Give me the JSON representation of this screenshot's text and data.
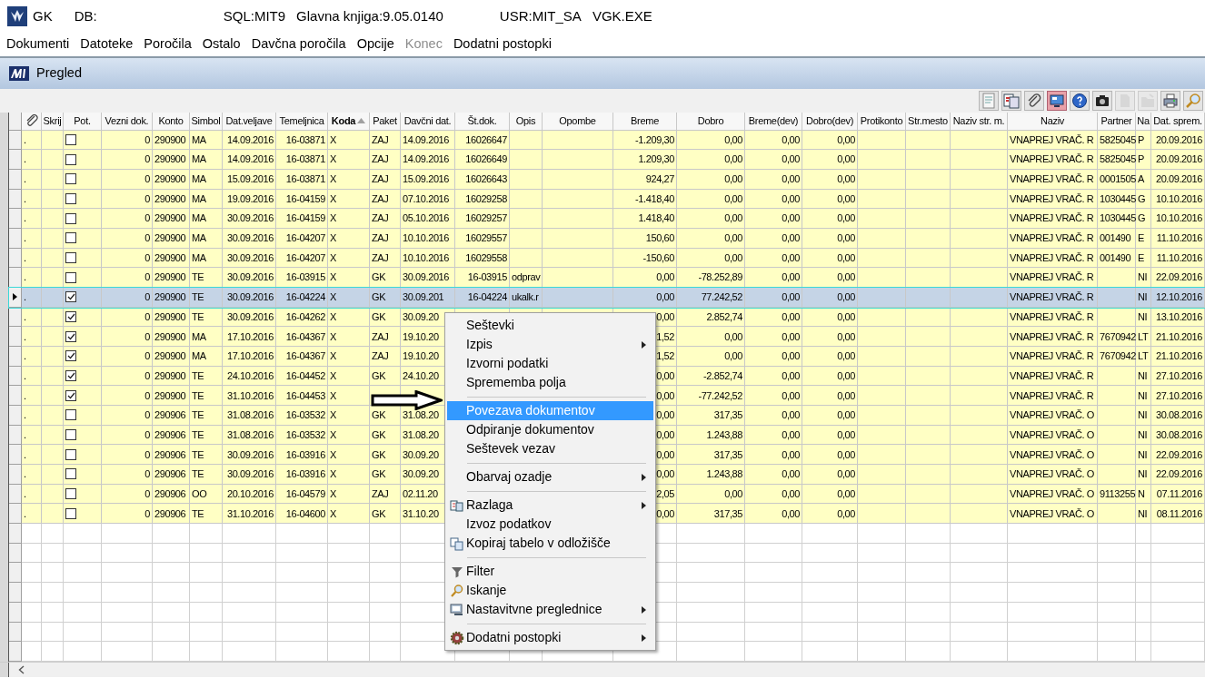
{
  "title_bar": {
    "app": "GK",
    "db": "DB:",
    "sql": "SQL:MIT9",
    "module": "Glavna knjiga:9.05.0140",
    "user": "USR:MIT_SA",
    "exe": "VGK.EXE"
  },
  "menu_bar": [
    {
      "label": "Dokumenti",
      "disabled": false
    },
    {
      "label": "Datoteke",
      "disabled": false
    },
    {
      "label": "Poročila",
      "disabled": false
    },
    {
      "label": "Ostalo",
      "disabled": false
    },
    {
      "label": "Davčna poročila",
      "disabled": false
    },
    {
      "label": "Opcije",
      "disabled": false
    },
    {
      "label": "Konec",
      "disabled": true
    },
    {
      "label": "Dodatni postopki",
      "disabled": false
    }
  ],
  "window": {
    "title": "Pregled"
  },
  "toolbar": [
    {
      "pressed": false,
      "disabled": false
    },
    {
      "pressed": false,
      "disabled": false
    },
    {
      "pressed": false,
      "disabled": false
    },
    {
      "pressed": true,
      "disabled": false
    },
    {
      "pressed": false,
      "disabled": false
    },
    {
      "pressed": false,
      "disabled": false
    },
    {
      "pressed": false,
      "disabled": true
    },
    {
      "pressed": false,
      "disabled": true
    },
    {
      "pressed": false,
      "disabled": false
    },
    {
      "pressed": false,
      "disabled": false
    }
  ],
  "table": {
    "columns": [
      {
        "kind": "icon",
        "sorted": false
      },
      {
        "label": "Skrij",
        "sorted": false
      },
      {
        "label": "Pot.",
        "sorted": false
      },
      {
        "label": "Vezni dok.",
        "sorted": false
      },
      {
        "label": "Konto",
        "sorted": false
      },
      {
        "label": "Simbol",
        "sorted": false
      },
      {
        "label": "Dat.veljave",
        "sorted": false
      },
      {
        "label": "Temeljnica",
        "sorted": false
      },
      {
        "label": "Koda",
        "sorted": true
      },
      {
        "label": "Paket",
        "sorted": false
      },
      {
        "label": "Davčni dat.",
        "sorted": false
      },
      {
        "label": "Št.dok.",
        "sorted": false
      },
      {
        "label": "Opis",
        "sorted": false
      },
      {
        "label": "Opombe",
        "sorted": false
      },
      {
        "label": "Breme",
        "sorted": false
      },
      {
        "label": "Dobro",
        "sorted": false
      },
      {
        "label": "Breme(dev)",
        "sorted": false
      },
      {
        "label": "Dobro(dev)",
        "sorted": false
      },
      {
        "label": "Protikonto",
        "sorted": false
      },
      {
        "label": "Str.mesto",
        "sorted": false
      },
      {
        "label": "Naziv str. m.",
        "sorted": false
      },
      {
        "label": "Naziv",
        "sorted": false
      },
      {
        "label": "Partner",
        "sorted": false
      },
      {
        "label": "Na",
        "sorted": false
      },
      {
        "label": "Dat. sprem.",
        "sorted": false
      }
    ],
    "rows": [
      {
        "selected": false,
        "checked": false,
        "cells": [
          ".",
          null,
          null,
          "0",
          "290900",
          "MA",
          "14.09.2016",
          "16-03871",
          "X",
          "ZAJ",
          "14.09.2016",
          "16026647",
          null,
          null,
          "-1.209,30",
          "0,00",
          "0,00",
          "0,00",
          null,
          null,
          null,
          "VNAPREJ VRAČ. R",
          "5825045",
          "P",
          "20.09.2016"
        ]
      },
      {
        "selected": false,
        "checked": false,
        "cells": [
          ".",
          null,
          null,
          "0",
          "290900",
          "MA",
          "14.09.2016",
          "16-03871",
          "X",
          "ZAJ",
          "14.09.2016",
          "16026649",
          null,
          null,
          "1.209,30",
          "0,00",
          "0,00",
          "0,00",
          null,
          null,
          null,
          "VNAPREJ VRAČ. R",
          "5825045",
          "P",
          "20.09.2016"
        ]
      },
      {
        "selected": false,
        "checked": false,
        "cells": [
          ".",
          null,
          null,
          "0",
          "290900",
          "MA",
          "15.09.2016",
          "16-03871",
          "X",
          "ZAJ",
          "15.09.2016",
          "16026643",
          null,
          null,
          "924,27",
          "0,00",
          "0,00",
          "0,00",
          null,
          null,
          null,
          "VNAPREJ VRAČ. R",
          "0001505",
          "A",
          "20.09.2016"
        ]
      },
      {
        "selected": false,
        "checked": false,
        "cells": [
          ".",
          null,
          null,
          "0",
          "290900",
          "MA",
          "19.09.2016",
          "16-04159",
          "X",
          "ZAJ",
          "07.10.2016",
          "16029258",
          null,
          null,
          "-1.418,40",
          "0,00",
          "0,00",
          "0,00",
          null,
          null,
          null,
          "VNAPREJ VRAČ. R",
          "1030445",
          "G",
          "10.10.2016"
        ]
      },
      {
        "selected": false,
        "checked": false,
        "cells": [
          ".",
          null,
          null,
          "0",
          "290900",
          "MA",
          "30.09.2016",
          "16-04159",
          "X",
          "ZAJ",
          "05.10.2016",
          "16029257",
          null,
          null,
          "1.418,40",
          "0,00",
          "0,00",
          "0,00",
          null,
          null,
          null,
          "VNAPREJ VRAČ. R",
          "1030445",
          "G",
          "10.10.2016"
        ]
      },
      {
        "selected": false,
        "checked": false,
        "cells": [
          ".",
          null,
          null,
          "0",
          "290900",
          "MA",
          "30.09.2016",
          "16-04207",
          "X",
          "ZAJ",
          "10.10.2016",
          "16029557",
          null,
          null,
          "150,60",
          "0,00",
          "0,00",
          "0,00",
          null,
          null,
          null,
          "VNAPREJ VRAČ. R",
          "001490",
          "E",
          "11.10.2016"
        ]
      },
      {
        "selected": false,
        "checked": false,
        "cells": [
          ".",
          null,
          null,
          "0",
          "290900",
          "MA",
          "30.09.2016",
          "16-04207",
          "X",
          "ZAJ",
          "10.10.2016",
          "16029558",
          null,
          null,
          "-150,60",
          "0,00",
          "0,00",
          "0,00",
          null,
          null,
          null,
          "VNAPREJ VRAČ. R",
          "001490",
          "E",
          "11.10.2016"
        ]
      },
      {
        "selected": false,
        "checked": false,
        "cells": [
          ".",
          null,
          null,
          "0",
          "290900",
          "TE",
          "30.09.2016",
          "16-03915",
          "X",
          "GK",
          "30.09.2016",
          "16-03915",
          "odprav",
          null,
          "0,00",
          "-78.252,89",
          "0,00",
          "0,00",
          null,
          null,
          null,
          "VNAPREJ VRAČ. R",
          null,
          "NI",
          "22.09.2016"
        ]
      },
      {
        "selected": true,
        "checked": true,
        "cells": [
          ".",
          null,
          null,
          "0",
          "290900",
          "TE",
          "30.09.2016",
          "16-04224",
          "X",
          "GK",
          "30.09.201",
          "16-04224",
          "ukalk.r",
          null,
          "0,00",
          "77.242,52",
          "0,00",
          "0,00",
          null,
          null,
          null,
          "VNAPREJ VRAČ. R",
          null,
          "NI",
          "12.10.2016"
        ]
      },
      {
        "selected": false,
        "checked": true,
        "cells": [
          ".",
          null,
          null,
          "0",
          "290900",
          "TE",
          "30.09.2016",
          "16-04262",
          "X",
          "GK",
          "30.09.20",
          null,
          null,
          null,
          "0,00",
          "2.852,74",
          "0,00",
          "0,00",
          null,
          null,
          null,
          "VNAPREJ VRAČ. R",
          null,
          "NI",
          "13.10.2016"
        ]
      },
      {
        "selected": false,
        "checked": true,
        "cells": [
          ".",
          null,
          null,
          "0",
          "290900",
          "MA",
          "17.10.2016",
          "16-04367",
          "X",
          "ZAJ",
          "19.10.20",
          null,
          null,
          null,
          "1,52",
          "0,00",
          "0,00",
          "0,00",
          null,
          null,
          null,
          "VNAPREJ VRAČ. R",
          "7670942",
          "LT",
          "21.10.2016"
        ]
      },
      {
        "selected": false,
        "checked": true,
        "cells": [
          ".",
          null,
          null,
          "0",
          "290900",
          "MA",
          "17.10.2016",
          "16-04367",
          "X",
          "ZAJ",
          "19.10.20",
          null,
          null,
          null,
          "1,52",
          "0,00",
          "0,00",
          "0,00",
          null,
          null,
          null,
          "VNAPREJ VRAČ. R",
          "7670942",
          "LT",
          "21.10.2016"
        ]
      },
      {
        "selected": false,
        "checked": true,
        "cells": [
          ".",
          null,
          null,
          "0",
          "290900",
          "TE",
          "24.10.2016",
          "16-04452",
          "X",
          "GK",
          "24.10.20",
          null,
          null,
          null,
          "0,00",
          "-2.852,74",
          "0,00",
          "0,00",
          null,
          null,
          null,
          "VNAPREJ VRAČ. R",
          null,
          "NI",
          "27.10.2016"
        ]
      },
      {
        "selected": false,
        "checked": true,
        "cells": [
          ".",
          null,
          null,
          "0",
          "290900",
          "TE",
          "31.10.2016",
          "16-04453",
          "X",
          null,
          null,
          null,
          null,
          null,
          "0,00",
          "-77.242,52",
          "0,00",
          "0,00",
          null,
          null,
          null,
          "VNAPREJ VRAČ. R",
          null,
          "NI",
          "27.10.2016"
        ]
      },
      {
        "selected": false,
        "checked": false,
        "cells": [
          ".",
          null,
          null,
          "0",
          "290906",
          "TE",
          "31.08.2016",
          "16-03532",
          "X",
          "GK",
          "31.08.20",
          null,
          null,
          null,
          "0,00",
          "317,35",
          "0,00",
          "0,00",
          null,
          null,
          null,
          "VNAPREJ VRAČ. O",
          null,
          "NI",
          "30.08.2016"
        ]
      },
      {
        "selected": false,
        "checked": false,
        "cells": [
          ".",
          null,
          null,
          "0",
          "290906",
          "TE",
          "31.08.2016",
          "16-03532",
          "X",
          "GK",
          "31.08.20",
          null,
          null,
          null,
          "0,00",
          "1.243,88",
          "0,00",
          "0,00",
          null,
          null,
          null,
          "VNAPREJ VRAČ. O",
          null,
          "NI",
          "30.08.2016"
        ]
      },
      {
        "selected": false,
        "checked": false,
        "cells": [
          ".",
          null,
          null,
          "0",
          "290906",
          "TE",
          "30.09.2016",
          "16-03916",
          "X",
          "GK",
          "30.09.20",
          null,
          null,
          null,
          "0,00",
          "317,35",
          "0,00",
          "0,00",
          null,
          null,
          null,
          "VNAPREJ VRAČ. O",
          null,
          "NI",
          "22.09.2016"
        ]
      },
      {
        "selected": false,
        "checked": false,
        "cells": [
          ".",
          null,
          null,
          "0",
          "290906",
          "TE",
          "30.09.2016",
          "16-03916",
          "X",
          "GK",
          "30.09.20",
          null,
          null,
          null,
          "0,00",
          "1.243,88",
          "0,00",
          "0,00",
          null,
          null,
          null,
          "VNAPREJ VRAČ. O",
          null,
          "NI",
          "22.09.2016"
        ]
      },
      {
        "selected": false,
        "checked": false,
        "cells": [
          ".",
          null,
          null,
          "0",
          "290906",
          "OO",
          "20.10.2016",
          "16-04579",
          "X",
          "ZAJ",
          "02.11.20",
          null,
          null,
          null,
          "2,05",
          "0,00",
          "0,00",
          "0,00",
          null,
          null,
          null,
          "VNAPREJ VRAČ. O",
          "9113255",
          "N",
          "07.11.2016"
        ]
      },
      {
        "selected": false,
        "checked": false,
        "cells": [
          ".",
          null,
          null,
          "0",
          "290906",
          "TE",
          "31.10.2016",
          "16-04600",
          "X",
          "GK",
          "31.10.20",
          null,
          null,
          null,
          "0,00",
          "317,35",
          "0,00",
          "0,00",
          null,
          null,
          null,
          "VNAPREJ VRAČ. O",
          null,
          "NI",
          "08.11.2016"
        ]
      }
    ]
  },
  "context_menu": [
    {
      "kind": "item",
      "label": "Seštevki",
      "selected": false,
      "submenu": false
    },
    {
      "kind": "item",
      "label": "Izpis",
      "selected": false,
      "submenu": true
    },
    {
      "kind": "item",
      "label": "Izvorni podatki",
      "selected": false,
      "submenu": false
    },
    {
      "kind": "item",
      "label": "Sprememba polja",
      "selected": false,
      "submenu": false
    },
    {
      "kind": "separator"
    },
    {
      "kind": "item",
      "label": "Povezava dokumentov",
      "selected": true,
      "submenu": false
    },
    {
      "kind": "item",
      "label": "Odpiranje dokumentov",
      "selected": false,
      "submenu": false
    },
    {
      "kind": "item",
      "label": "Seštevek vezav",
      "selected": false,
      "submenu": false
    },
    {
      "kind": "separator"
    },
    {
      "kind": "item",
      "label": "Obarvaj ozadje",
      "selected": false,
      "submenu": true
    },
    {
      "kind": "separator"
    },
    {
      "kind": "item",
      "label": "Razlaga",
      "selected": false,
      "submenu": true
    },
    {
      "kind": "item",
      "label": "Izvoz podatkov",
      "selected": false,
      "submenu": false
    },
    {
      "kind": "item",
      "label": "Kopiraj tabelo v odložišče",
      "selected": false,
      "submenu": false
    },
    {
      "kind": "separator"
    },
    {
      "kind": "item",
      "label": "Filter",
      "selected": false,
      "submenu": false
    },
    {
      "kind": "item",
      "label": "Iskanje",
      "selected": false,
      "submenu": false
    },
    {
      "kind": "item",
      "label": "Nastavitvne preglednice",
      "selected": false,
      "submenu": true
    },
    {
      "kind": "separator"
    },
    {
      "kind": "item",
      "label": "Dodatni postopki",
      "selected": false,
      "submenu": true
    }
  ]
}
